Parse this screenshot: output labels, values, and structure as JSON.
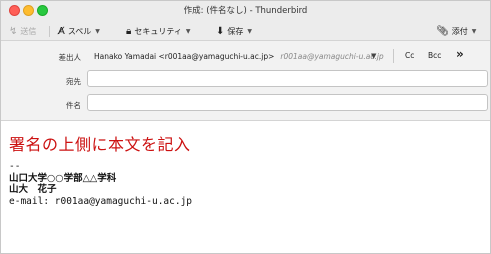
{
  "window": {
    "title": "作成: (件名なし) - Thunderbird"
  },
  "toolbar": {
    "send": "送信",
    "spell": "スペル",
    "security": "セキュリティ",
    "save": "保存",
    "attach": "添付"
  },
  "headers": {
    "from_label": "差出人",
    "from_value": "Hanako Yamadai <r001aa@yamaguchi-u.ac.jp>",
    "from_alias": "r001aa@yamaguchi-u.ac.jp",
    "cc": "Cc",
    "bcc": "Bcc",
    "more": "»",
    "to_label": "宛先",
    "subject_label": "件名",
    "to_value": "",
    "subject_value": ""
  },
  "body": {
    "heading": "署名の上側に本文を記入",
    "sig_sep": "--",
    "sig_line1": "山口大学○○学部△△学科",
    "sig_line2": "山大　花子",
    "sig_email": "e-mail: r001aa@yamaguchi-u.ac.jp"
  }
}
